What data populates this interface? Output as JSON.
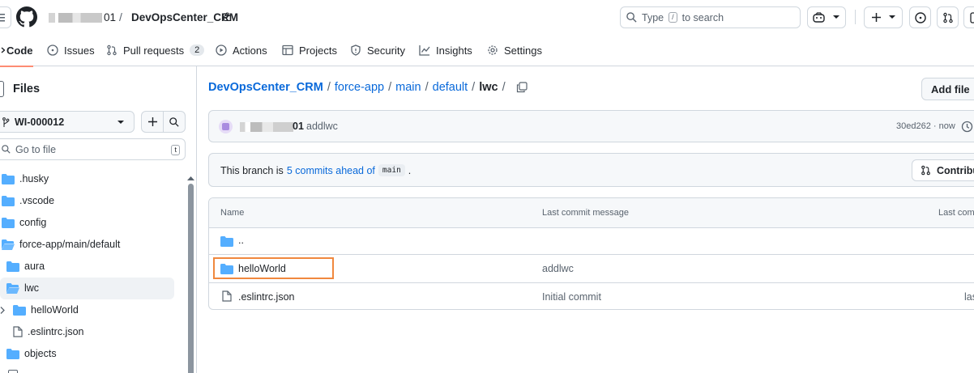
{
  "header": {
    "owner": "▐░░▌01",
    "separator": "/",
    "repo": "DevOpsCenter_CRM",
    "search_placeholder_prefix": "Type",
    "search_key": "/",
    "search_placeholder_suffix": "to search"
  },
  "tabs": [
    {
      "label": "Code",
      "icon": "code-icon",
      "active": true
    },
    {
      "label": "Issues",
      "icon": "issues-icon"
    },
    {
      "label": "Pull requests",
      "icon": "pull-request-icon",
      "count": "2"
    },
    {
      "label": "Actions",
      "icon": "play-icon"
    },
    {
      "label": "Projects",
      "icon": "table-icon"
    },
    {
      "label": "Security",
      "icon": "shield-icon"
    },
    {
      "label": "Insights",
      "icon": "graph-icon"
    },
    {
      "label": "Settings",
      "icon": "gear-icon"
    }
  ],
  "sidebar": {
    "title": "Files",
    "branch": "WI-000012",
    "goto_placeholder": "Go to file",
    "goto_key": "t",
    "tree": [
      {
        "label": ".husky",
        "type": "folder"
      },
      {
        "label": ".vscode",
        "type": "folder"
      },
      {
        "label": "config",
        "type": "folder"
      },
      {
        "label": "force-app/main/default",
        "type": "folder-open"
      },
      {
        "label": "aura",
        "type": "folder"
      },
      {
        "label": "lwc",
        "type": "folder-open",
        "selected": true
      },
      {
        "label": "helloWorld",
        "type": "folder"
      },
      {
        "label": ".eslintrc.json",
        "type": "file"
      },
      {
        "label": "objects",
        "type": "folder"
      }
    ]
  },
  "breadcrumb": {
    "repo": "DevOpsCenter_CRM",
    "parts": [
      "force-app",
      "main",
      "default"
    ],
    "current": "lwc",
    "trailing": "/"
  },
  "add_file_label": "Add file",
  "commit": {
    "author": "▐░░▌01",
    "message": "addlwc",
    "hash_time": "30ed262 · now"
  },
  "branch_notice": {
    "prefix": "This branch is",
    "link": "5 commits ahead of",
    "base": "main",
    "suffix": ".",
    "contribute_label": "Contribu"
  },
  "table": {
    "headers": [
      "Name",
      "Last commit message",
      "Last comm"
    ],
    "rows": [
      {
        "name": "..",
        "type": "folder",
        "message": "",
        "date": ""
      },
      {
        "name": "helloWorld",
        "type": "folder",
        "message": "addlwc",
        "date": "",
        "highlighted": true
      },
      {
        "name": ".eslintrc.json",
        "type": "file",
        "message": "Initial commit",
        "date": "las"
      }
    ]
  },
  "colors": {
    "link": "#0969da",
    "folder": "#54aeff",
    "highlight_border": "#f0883e",
    "active_tab_underline": "#fd8c73"
  }
}
